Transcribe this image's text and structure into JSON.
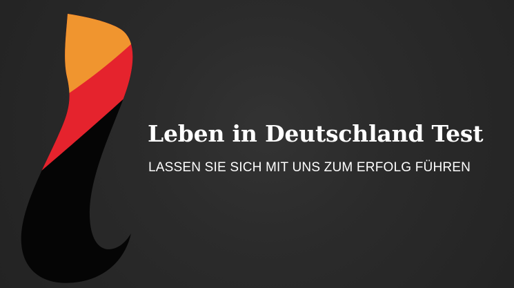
{
  "brand": {
    "title": "Leben in Deutschland Test",
    "subtitle": "LASSEN SIE SICH MIT UNS ZUM ERFOLG FÜHREN",
    "logo_icon": "stylized-l-flag-logo-icon"
  },
  "colors": {
    "background": "#2a2a2a",
    "text": "#ffffff",
    "flag_black": "#050505",
    "flag_red": "#e5232d",
    "flag_gold": "#f0952f"
  }
}
